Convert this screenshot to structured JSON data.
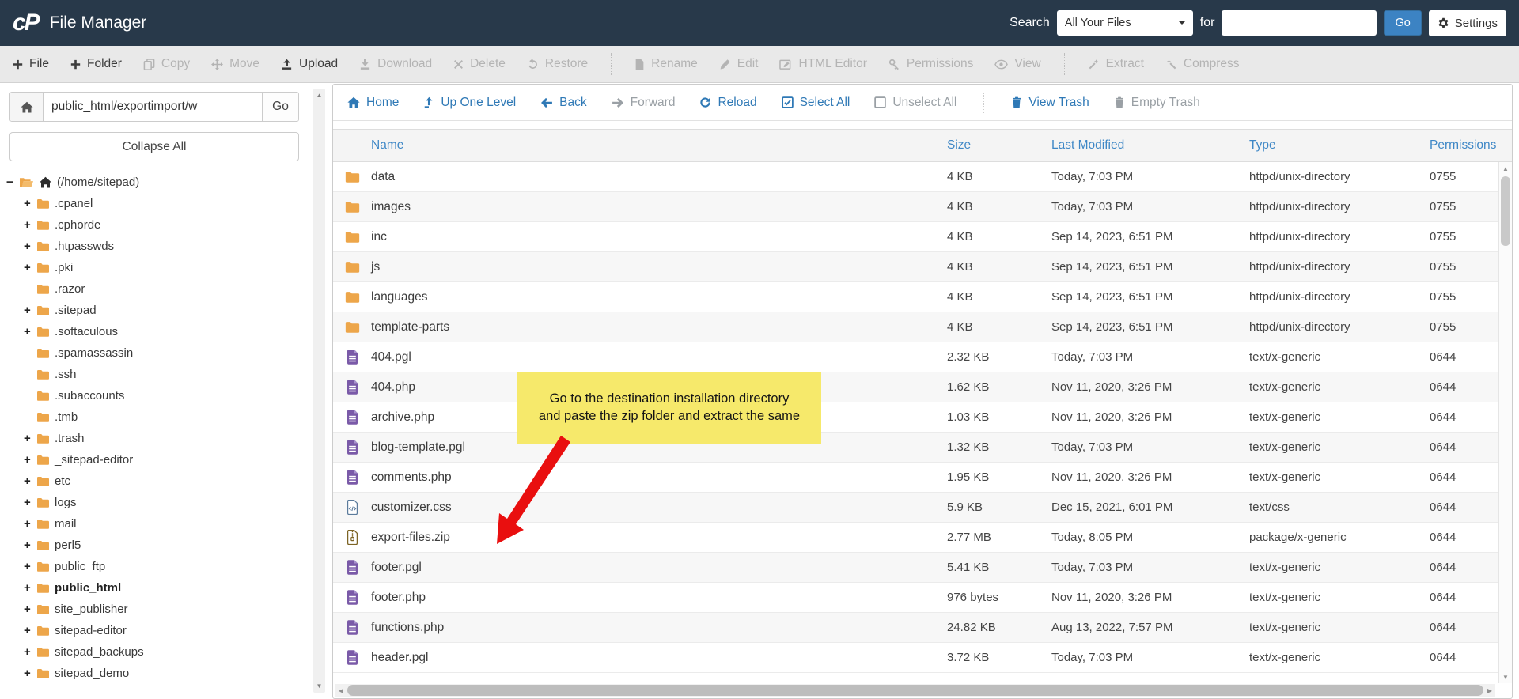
{
  "topbar": {
    "logo": "cP",
    "title": "File Manager",
    "search_label": "Search",
    "search_scope_selected": "All Your Files",
    "for_label": "for",
    "search_value": "",
    "go_label": "Go",
    "settings_label": "Settings"
  },
  "toolbar": {
    "items": [
      {
        "label": "File",
        "icon": "plus",
        "enabled": true
      },
      {
        "label": "Folder",
        "icon": "plus",
        "enabled": true
      },
      {
        "label": "Copy",
        "icon": "copy",
        "enabled": false
      },
      {
        "label": "Move",
        "icon": "move",
        "enabled": false
      },
      {
        "label": "Upload",
        "icon": "upload",
        "enabled": true
      },
      {
        "label": "Download",
        "icon": "download",
        "enabled": false
      },
      {
        "label": "Delete",
        "icon": "delete",
        "enabled": false
      },
      {
        "label": "Restore",
        "icon": "restore",
        "enabled": false
      },
      {
        "label": "Rename",
        "icon": "rename",
        "enabled": false,
        "sep_before": true
      },
      {
        "label": "Edit",
        "icon": "edit",
        "enabled": false
      },
      {
        "label": "HTML Editor",
        "icon": "html-editor",
        "enabled": false
      },
      {
        "label": "Permissions",
        "icon": "permissions",
        "enabled": false
      },
      {
        "label": "View",
        "icon": "view",
        "enabled": false
      },
      {
        "label": "Extract",
        "icon": "extract",
        "enabled": false,
        "sep_before": true
      },
      {
        "label": "Compress",
        "icon": "compress",
        "enabled": false
      }
    ]
  },
  "sidebar": {
    "path_value": "public_html/exportimport/w",
    "path_go_label": "Go",
    "collapse_all_label": "Collapse All",
    "tree": [
      {
        "expander": "−",
        "label": "(/home/sitepad)",
        "root": true
      },
      {
        "expander": "+",
        "label": ".cpanel"
      },
      {
        "expander": "+",
        "label": ".cphorde"
      },
      {
        "expander": "+",
        "label": ".htpasswds"
      },
      {
        "expander": "+",
        "label": ".pki"
      },
      {
        "expander": "",
        "label": ".razor"
      },
      {
        "expander": "+",
        "label": ".sitepad"
      },
      {
        "expander": "+",
        "label": ".softaculous"
      },
      {
        "expander": "",
        "label": ".spamassassin"
      },
      {
        "expander": "",
        "label": ".ssh"
      },
      {
        "expander": "",
        "label": ".subaccounts"
      },
      {
        "expander": "",
        "label": ".tmb"
      },
      {
        "expander": "+",
        "label": ".trash"
      },
      {
        "expander": "+",
        "label": "_sitepad-editor"
      },
      {
        "expander": "+",
        "label": "etc"
      },
      {
        "expander": "+",
        "label": "logs"
      },
      {
        "expander": "+",
        "label": "mail"
      },
      {
        "expander": "+",
        "label": "perl5"
      },
      {
        "expander": "+",
        "label": "public_ftp"
      },
      {
        "expander": "+",
        "label": "public_html",
        "bold": true
      },
      {
        "expander": "+",
        "label": "site_publisher"
      },
      {
        "expander": "+",
        "label": "sitepad-editor"
      },
      {
        "expander": "+",
        "label": "sitepad_backups"
      },
      {
        "expander": "+",
        "label": "sitepad_demo"
      }
    ]
  },
  "filebrowser": {
    "nav_items": [
      {
        "label": "Home",
        "icon": "home",
        "enabled": true
      },
      {
        "label": "Up One Level",
        "icon": "up-arrow",
        "enabled": true
      },
      {
        "label": "Back",
        "icon": "left-arrow",
        "enabled": true
      },
      {
        "label": "Forward",
        "icon": "right-arrow",
        "enabled": false
      },
      {
        "label": "Reload",
        "icon": "reload",
        "enabled": true
      },
      {
        "label": "Select All",
        "icon": "select-all",
        "enabled": true
      },
      {
        "label": "Unselect All",
        "icon": "unselect-all",
        "enabled": false
      },
      {
        "label": "View Trash",
        "icon": "trash",
        "enabled": true,
        "sep_before": true
      },
      {
        "label": "Empty Trash",
        "icon": "trash",
        "enabled": false
      }
    ],
    "columns": [
      "Name",
      "Size",
      "Last Modified",
      "Type",
      "Permissions"
    ],
    "rows": [
      {
        "icon": "folder",
        "name": "data",
        "size": "4 KB",
        "modified": "Today, 7:03 PM",
        "type": "httpd/unix-directory",
        "perms": "0755"
      },
      {
        "icon": "folder",
        "name": "images",
        "size": "4 KB",
        "modified": "Today, 7:03 PM",
        "type": "httpd/unix-directory",
        "perms": "0755"
      },
      {
        "icon": "folder",
        "name": "inc",
        "size": "4 KB",
        "modified": "Sep 14, 2023, 6:51 PM",
        "type": "httpd/unix-directory",
        "perms": "0755"
      },
      {
        "icon": "folder",
        "name": "js",
        "size": "4 KB",
        "modified": "Sep 14, 2023, 6:51 PM",
        "type": "httpd/unix-directory",
        "perms": "0755"
      },
      {
        "icon": "folder",
        "name": "languages",
        "size": "4 KB",
        "modified": "Sep 14, 2023, 6:51 PM",
        "type": "httpd/unix-directory",
        "perms": "0755"
      },
      {
        "icon": "folder",
        "name": "template-parts",
        "size": "4 KB",
        "modified": "Sep 14, 2023, 6:51 PM",
        "type": "httpd/unix-directory",
        "perms": "0755"
      },
      {
        "icon": "text-file",
        "name": "404.pgl",
        "size": "2.32 KB",
        "modified": "Today, 7:03 PM",
        "type": "text/x-generic",
        "perms": "0644"
      },
      {
        "icon": "text-file",
        "name": "404.php",
        "size": "1.62 KB",
        "modified": "Nov 11, 2020, 3:26 PM",
        "type": "text/x-generic",
        "perms": "0644"
      },
      {
        "icon": "text-file",
        "name": "archive.php",
        "size": "1.03 KB",
        "modified": "Nov 11, 2020, 3:26 PM",
        "type": "text/x-generic",
        "perms": "0644"
      },
      {
        "icon": "text-file",
        "name": "blog-template.pgl",
        "size": "1.32 KB",
        "modified": "Today, 7:03 PM",
        "type": "text/x-generic",
        "perms": "0644"
      },
      {
        "icon": "text-file",
        "name": "comments.php",
        "size": "1.95 KB",
        "modified": "Nov 11, 2020, 3:26 PM",
        "type": "text/x-generic",
        "perms": "0644"
      },
      {
        "icon": "css-file",
        "name": "customizer.css",
        "size": "5.9 KB",
        "modified": "Dec 15, 2021, 6:01 PM",
        "type": "text/css",
        "perms": "0644"
      },
      {
        "icon": "zip-file",
        "name": "export-files.zip",
        "size": "2.77 MB",
        "modified": "Today, 8:05 PM",
        "type": "package/x-generic",
        "perms": "0644"
      },
      {
        "icon": "text-file",
        "name": "footer.pgl",
        "size": "5.41 KB",
        "modified": "Today, 7:03 PM",
        "type": "text/x-generic",
        "perms": "0644"
      },
      {
        "icon": "text-file",
        "name": "footer.php",
        "size": "976 bytes",
        "modified": "Nov 11, 2020, 3:26 PM",
        "type": "text/x-generic",
        "perms": "0644"
      },
      {
        "icon": "text-file",
        "name": "functions.php",
        "size": "24.82 KB",
        "modified": "Aug 13, 2022, 7:57 PM",
        "type": "text/x-generic",
        "perms": "0644"
      },
      {
        "icon": "text-file",
        "name": "header.pgl",
        "size": "3.72 KB",
        "modified": "Today, 7:03 PM",
        "type": "text/x-generic",
        "perms": "0644"
      }
    ]
  },
  "annotation": {
    "note_text": "Go to the destination installation directory and paste the zip folder and extract the same"
  },
  "colors": {
    "topbar_bg": "#28394a",
    "accent_blue": "#2f79b6",
    "header_blue": "#3e87c6",
    "button_blue": "#3c83c3",
    "folder_orange": "#eda64a",
    "file_purple": "#7a5aa8",
    "note_yellow": "#f6e96b",
    "arrow_red": "#e90f0f"
  }
}
